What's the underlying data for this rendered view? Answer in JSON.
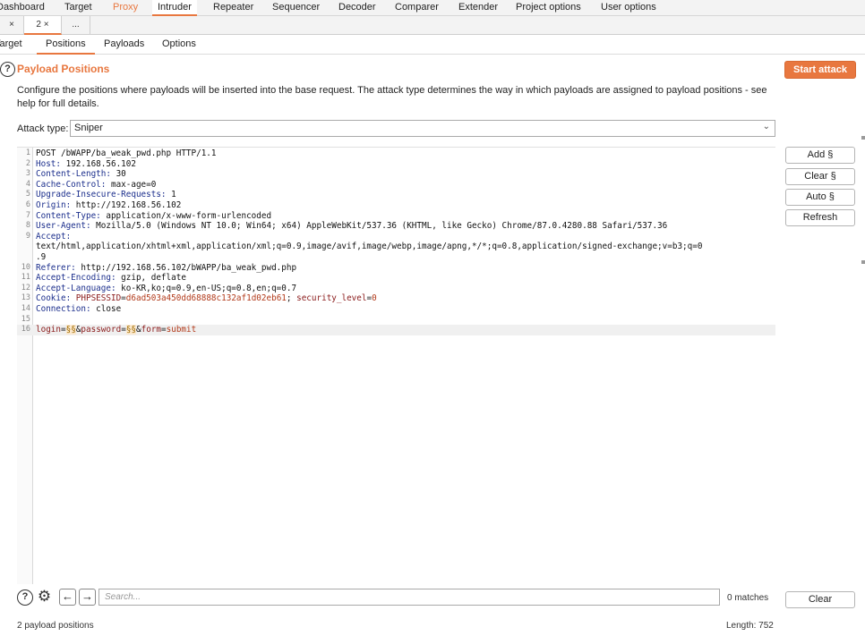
{
  "top_menu": {
    "items": [
      "Dashboard",
      "Target",
      "Proxy",
      "Intruder",
      "Repeater",
      "Sequencer",
      "Decoder",
      "Comparer",
      "Extender",
      "Project options",
      "User options"
    ]
  },
  "sub_tabs": {
    "items": [
      "×",
      "2 ×",
      "..."
    ]
  },
  "intruder_tabs": {
    "items": [
      "Target",
      "Positions",
      "Payloads",
      "Options"
    ]
  },
  "positions": {
    "title": "Payload Positions",
    "start_attack": "Start attack",
    "description": "Configure the positions where payloads will be inserted into the base request. The attack type determines the way in which payloads are assigned to payload positions - see help for full details.",
    "attack_type_label": "Attack type:",
    "attack_type_value": "Sniper"
  },
  "request": {
    "lines": [
      {
        "n": "1",
        "key": "",
        "val": "POST /bWAPP/ba_weak_pwd.php HTTP/1.1"
      },
      {
        "n": "2",
        "key": "Host:",
        "val": " 192.168.56.102"
      },
      {
        "n": "3",
        "key": "Content-Length:",
        "val": " 30"
      },
      {
        "n": "4",
        "key": "Cache-Control:",
        "val": " max-age=0"
      },
      {
        "n": "5",
        "key": "Upgrade-Insecure-Requests:",
        "val": " 1"
      },
      {
        "n": "6",
        "key": "Origin:",
        "val": " http://192.168.56.102"
      },
      {
        "n": "7",
        "key": "Content-Type:",
        "val": " application/x-www-form-urlencoded"
      },
      {
        "n": "8",
        "key": "User-Agent:",
        "val": " Mozilla/5.0 (Windows NT 10.0; Win64; x64) AppleWebKit/537.36 (KHTML, like Gecko) Chrome/87.0.4280.88 Safari/537.36"
      },
      {
        "n": "9",
        "key": "Accept:",
        "val": ""
      },
      {
        "n": "",
        "key": "",
        "val": "text/html,application/xhtml+xml,application/xml;q=0.9,image/avif,image/webp,image/apng,*/*;q=0.8,application/signed-exchange;v=b3;q=0"
      },
      {
        "n": "",
        "key": "",
        "val": ".9"
      },
      {
        "n": "10",
        "key": "Referer:",
        "val": " http://192.168.56.102/bWAPP/ba_weak_pwd.php"
      },
      {
        "n": "11",
        "key": "Accept-Encoding:",
        "val": " gzip, deflate"
      },
      {
        "n": "12",
        "key": "Accept-Language:",
        "val": " ko-KR,ko;q=0.9,en-US;q=0.8,en;q=0.7"
      },
      {
        "n": "13",
        "key": "Cookie:",
        "val": ""
      },
      {
        "n": "14",
        "key": "Connection:",
        "val": " close"
      },
      {
        "n": "15",
        "key": "",
        "val": ""
      },
      {
        "n": "16",
        "key": "",
        "val": ""
      }
    ],
    "cookie": {
      "name1": "PHPSESSID",
      "val1": "d6ad503a450dd68888c132af1d02eb61",
      "sep": "; ",
      "name2": "security_level",
      "val2": "0"
    },
    "body": {
      "p1": "login",
      "eq1": "=",
      "m1": "§§",
      "amp1": "&",
      "p2": "password",
      "eq2": "=",
      "m2": "§§",
      "amp2": "&",
      "p3": "form",
      "eq3": "=",
      "v3": "submit"
    }
  },
  "side_buttons": [
    "Add §",
    "Clear §",
    "Auto §",
    "Refresh"
  ],
  "search": {
    "placeholder": "Search...",
    "matches": "0 matches",
    "clear": "Clear"
  },
  "status": {
    "positions": "2 payload positions",
    "length": "Length: 752"
  },
  "icons": {
    "help": "?",
    "settings": "⚙",
    "back": "←",
    "forward": "→"
  },
  "colors": {
    "accent": "#e8773f"
  }
}
